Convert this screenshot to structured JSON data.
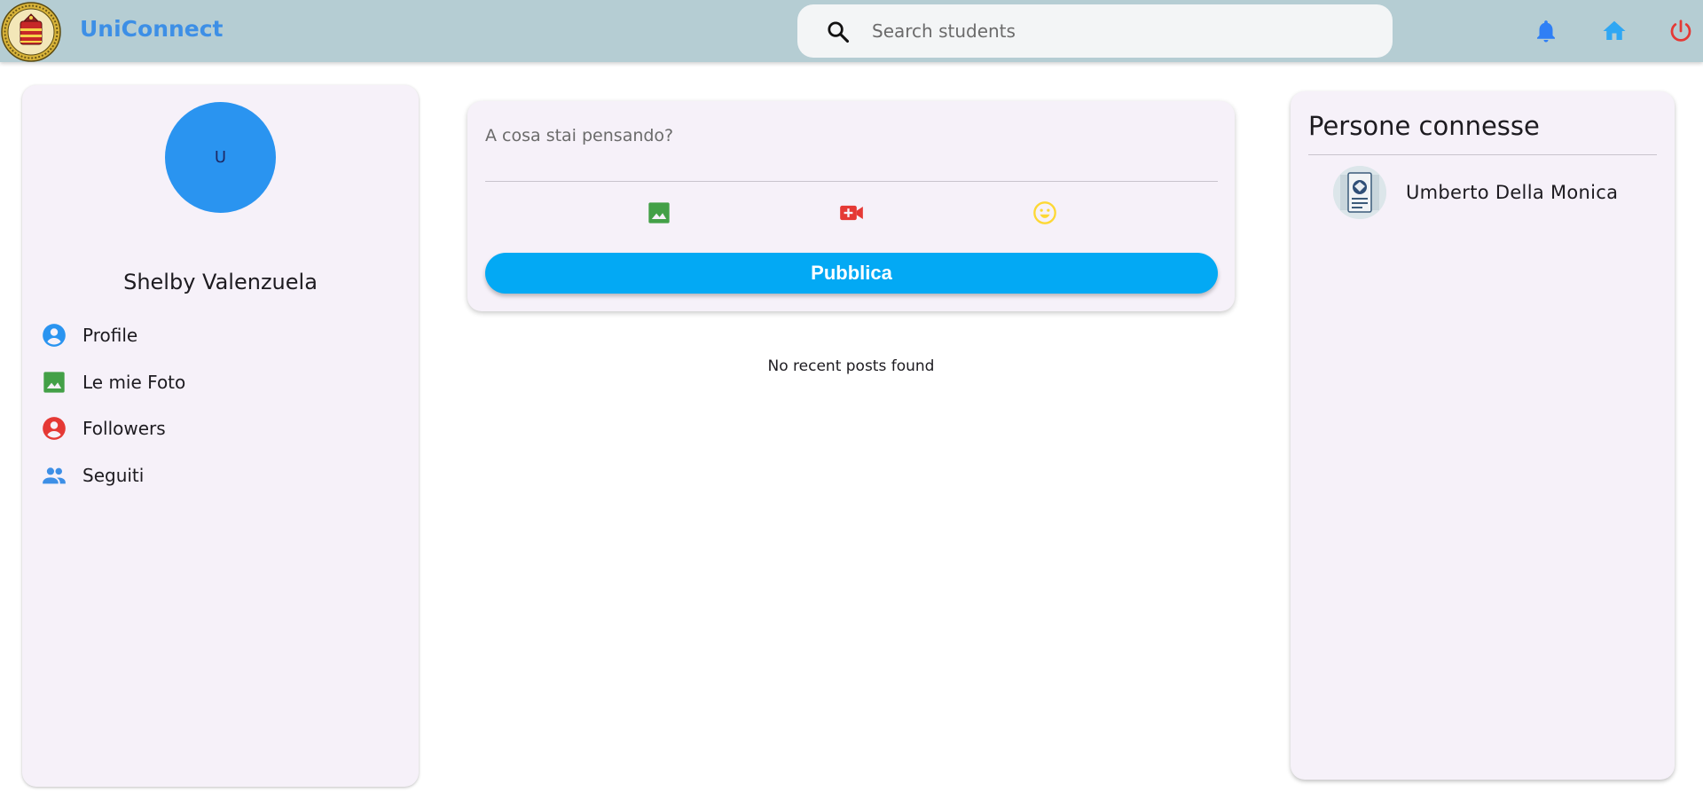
{
  "header": {
    "app_title": "UniConnect",
    "search_placeholder": "Search students",
    "icons": [
      "bell-icon",
      "home-icon",
      "power-icon"
    ],
    "colors": {
      "bar": "#b5cdd3",
      "title": "#3d8fe6",
      "bell": "#2f7ff5",
      "home": "#2fa7f3",
      "power": "#e53935"
    }
  },
  "profile": {
    "avatar_initial": "U",
    "name": "Shelby Valenzuela",
    "menu": [
      {
        "label": "Profile",
        "icon": "account-circle-icon",
        "color": "#2a94f0"
      },
      {
        "label": "Le mie Foto",
        "icon": "image-icon",
        "color": "#43a047"
      },
      {
        "label": "Followers",
        "icon": "account-circle-icon",
        "color": "#e53935"
      },
      {
        "label": "Seguiti",
        "icon": "people-icon",
        "color": "#3d8fe6"
      }
    ]
  },
  "composer": {
    "placeholder": "A cosa stai pensando?",
    "media_icons": [
      "image-icon",
      "video-add-icon",
      "emoji-icon"
    ],
    "publish_label": "Pubblica",
    "publish_color": "#03a9f4"
  },
  "feed": {
    "empty_message": "No recent posts found"
  },
  "connected": {
    "title": "Persone connesse",
    "people": [
      {
        "name": "Umberto Della Monica"
      }
    ]
  }
}
